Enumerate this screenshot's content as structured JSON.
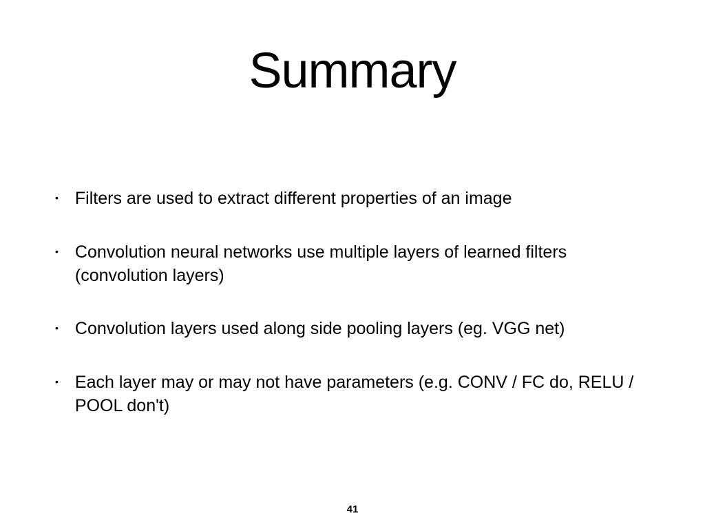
{
  "slide": {
    "title": "Summary",
    "bullets": [
      "Filters are used to extract different properties of an image",
      "Convolution neural networks use multiple layers of learned filters (convolution layers)",
      "Convolution layers used along side pooling layers (eg. VGG net)",
      "Each layer may or may not have parameters (e.g. CONV / FC do, RELU / POOL don't)"
    ],
    "page_number": "41"
  }
}
